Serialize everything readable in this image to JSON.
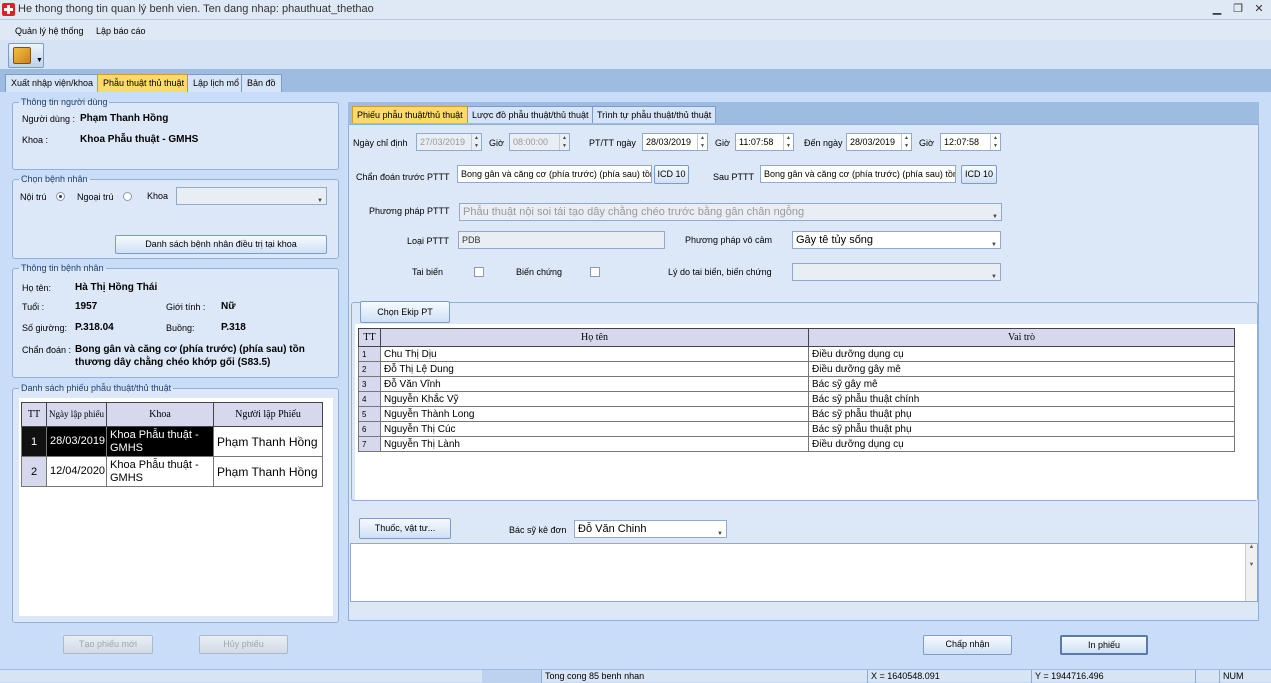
{
  "window": {
    "title": "He thong thong tin quan lý benh vien. Ten dang nhap: phauthuat_thethao",
    "minimize": "▁",
    "restore": "❐",
    "close": "✕"
  },
  "menu": {
    "items": [
      "Quản lý hệ thống",
      "Lập báo cáo"
    ]
  },
  "toolbar": {
    "main_icon": "tools-icon"
  },
  "main_tabs": [
    "Xuất nhập viện/khoa",
    "Phẫu thuật thủ thuật",
    "Lập lịch mổ",
    "Bản đồ"
  ],
  "user_info": {
    "legend": "Thông tin người dùng",
    "user_label": "Người dùng :",
    "user_value": "Phạm Thanh Hồng",
    "dept_label": "Khoa :",
    "dept_value": "Khoa Phẫu thuật - GMHS"
  },
  "choose_patient": {
    "legend": "Chọn bệnh nhân",
    "inpatient": "Nội trú",
    "outpatient": "Ngoại trú",
    "dept_label": "Khoa",
    "list_button": "Danh sách bệnh nhân điều trị tại khoa"
  },
  "patient_info": {
    "legend": "Thông tin bệnh nhân",
    "name_label": "Họ tên:",
    "name_value": "Hà Thị Hồng Thái",
    "age_label": "Tuổi :",
    "age_value": "1957",
    "gender_label": "Giới tính :",
    "gender_value": "Nữ",
    "bed_label": "Số giường:",
    "bed_value": "P.318.04",
    "room_label": "Buồng:",
    "room_value": "P.318",
    "diag_label": "Chẩn đoán :",
    "diag_line1": "Bong gân và căng cơ (phía trước) (phía sau) tồn",
    "diag_line2": "thương dây chằng chéo khớp gối (S83.5)"
  },
  "form_list": {
    "legend": "Danh sách phiếu phẫu thuật/thủ thuật",
    "headers": [
      "TT",
      "Ngày lập phiếu",
      "Khoa",
      "Người lập Phiếu"
    ],
    "rows": [
      {
        "tt": "1",
        "date": "28/03/2019",
        "dept": "Khoa Phẫu thuật - GMHS",
        "creator": "Phạm Thanh Hồng"
      },
      {
        "tt": "2",
        "date": "12/04/2020",
        "dept": "Khoa Phẫu thuật - GMHS",
        "creator": "Phạm Thanh Hồng"
      }
    ],
    "new_button": "Tạo phiếu mới",
    "cancel_button": "Hủy phiếu"
  },
  "right_tabs": [
    "Phiếu phẫu thuật/thủ thuật",
    "Lược đồ phẫu thuật/thủ thuật",
    "Trình tự phẫu thuật/thủ thuật"
  ],
  "form": {
    "order_date_label": "Ngày chỉ định",
    "order_date": "27/03/2019",
    "time_label": "Giờ",
    "order_time": "08:00:00",
    "pt_date_label": "PT/TT ngày",
    "pt_date": "28/03/2019",
    "pt_time": "11:07:58",
    "to_date_label": "Đến ngày",
    "to_date": "28/03/2019",
    "to_time": "12:07:58",
    "pre_diag_label": "Chẩn đoán trước PTTT",
    "pre_diag": "Bong gân và căng cơ (phía trước) (phía sau) tồn",
    "icd_label": "ICD 10",
    "post_diag_label": "Sau PTTT",
    "post_diag": "Bong gân và căng cơ (phía trước) (phía sau) tồn",
    "method_label": "Phương pháp PTTT",
    "method": "Phẫu thuật nội soi tái tạo dây chằng chéo trước bằng gân chân ngỗng",
    "type_label": "Loại PTTT",
    "type": "PDB",
    "anesth_label": "Phương pháp vô cảm",
    "anesth": "Gây tê tủy sống",
    "accident_label": "Tai biến",
    "complication_label": "Biến chứng",
    "reason_label": "Lý do tai biến, biến chứng"
  },
  "team": {
    "button": "Chọn Ekip PT",
    "headers": [
      "TT",
      "Họ tên",
      "Vai trò"
    ],
    "rows": [
      {
        "tt": "1",
        "name": "Chu Thị Dịu",
        "role": "Điều dưỡng dụng cụ"
      },
      {
        "tt": "2",
        "name": "Đỗ Thị Lệ Dung",
        "role": "Điều dưỡng gây mê"
      },
      {
        "tt": "3",
        "name": "Đỗ Văn Vĩnh",
        "role": "Bác sỹ gây mê"
      },
      {
        "tt": "4",
        "name": "Nguyễn Khắc Vỹ",
        "role": "Bác sỹ phẫu thuật chính"
      },
      {
        "tt": "5",
        "name": "Nguyễn Thành Long",
        "role": "Bác sỹ phẫu thuật phụ"
      },
      {
        "tt": "6",
        "name": "Nguyễn Thị Cúc",
        "role": "Bác sỹ phẫu thuật phụ"
      },
      {
        "tt": "7",
        "name": "Nguyễn Thị Lành",
        "role": "Điều dưỡng dụng cụ"
      }
    ]
  },
  "medicine": {
    "button": "Thuốc, vật tư...",
    "doctor_label": "Bác sỹ kê đơn",
    "doctor": "Đỗ Văn Chinh"
  },
  "actions": {
    "accept": "Chấp nhận",
    "print": "In phiếu"
  },
  "status": {
    "count": "Tong cong 85 benh nhan",
    "x": "X = 1640548.091",
    "y": "Y = 1944716.496",
    "num": "NUM"
  }
}
